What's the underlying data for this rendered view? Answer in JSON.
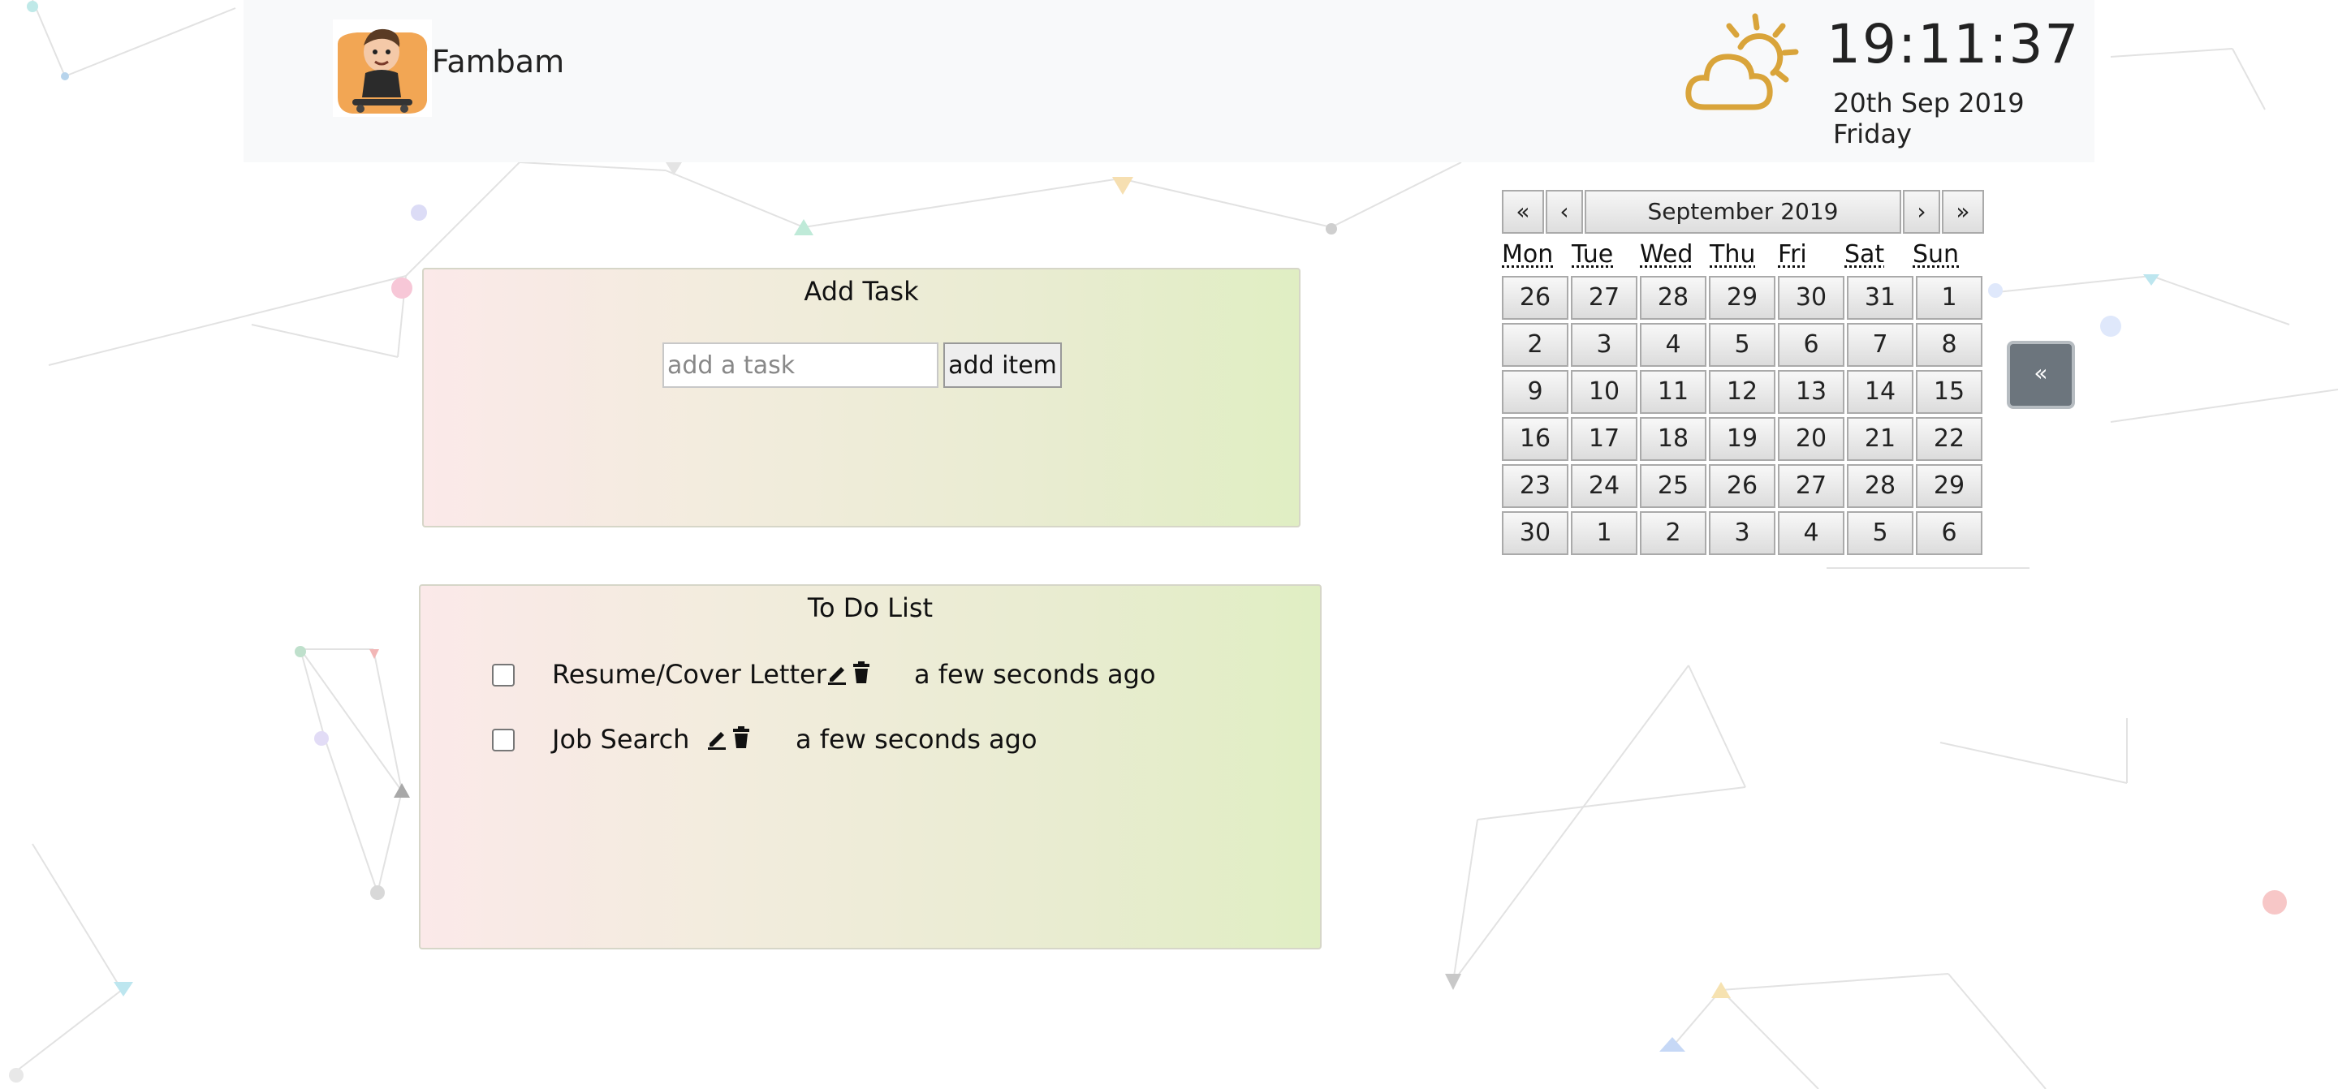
{
  "header": {
    "brand": "Fambam",
    "time": "19:11:37",
    "date": "20th Sep 2019 Friday",
    "weather_icon": "partly-cloudy-icon",
    "accent_color": "#d9a43a"
  },
  "add_task": {
    "title": "Add Task",
    "input_placeholder": "add a task",
    "input_value": "",
    "button_label": "add item"
  },
  "todo": {
    "title": "To Do List",
    "items": [
      {
        "text": "Resume/Cover Letter",
        "time": "a few seconds ago",
        "checked": false
      },
      {
        "text": "Job Search",
        "time": "a few seconds ago",
        "checked": false
      }
    ]
  },
  "calendar": {
    "month_label": "September 2019",
    "prev_year": "«",
    "prev_month": "‹",
    "next_month": "›",
    "next_year": "»",
    "weekdays": [
      "Mon",
      "Tue",
      "Wed",
      "Thu",
      "Fri",
      "Sat",
      "Sun"
    ],
    "weeks": [
      [
        "26",
        "27",
        "28",
        "29",
        "30",
        "31",
        "1"
      ],
      [
        "2",
        "3",
        "4",
        "5",
        "6",
        "7",
        "8"
      ],
      [
        "9",
        "10",
        "11",
        "12",
        "13",
        "14",
        "15"
      ],
      [
        "16",
        "17",
        "18",
        "19",
        "20",
        "21",
        "22"
      ],
      [
        "23",
        "24",
        "25",
        "26",
        "27",
        "28",
        "29"
      ],
      [
        "30",
        "1",
        "2",
        "3",
        "4",
        "5",
        "6"
      ]
    ]
  },
  "sidebar_toggle": {
    "label": "«"
  }
}
